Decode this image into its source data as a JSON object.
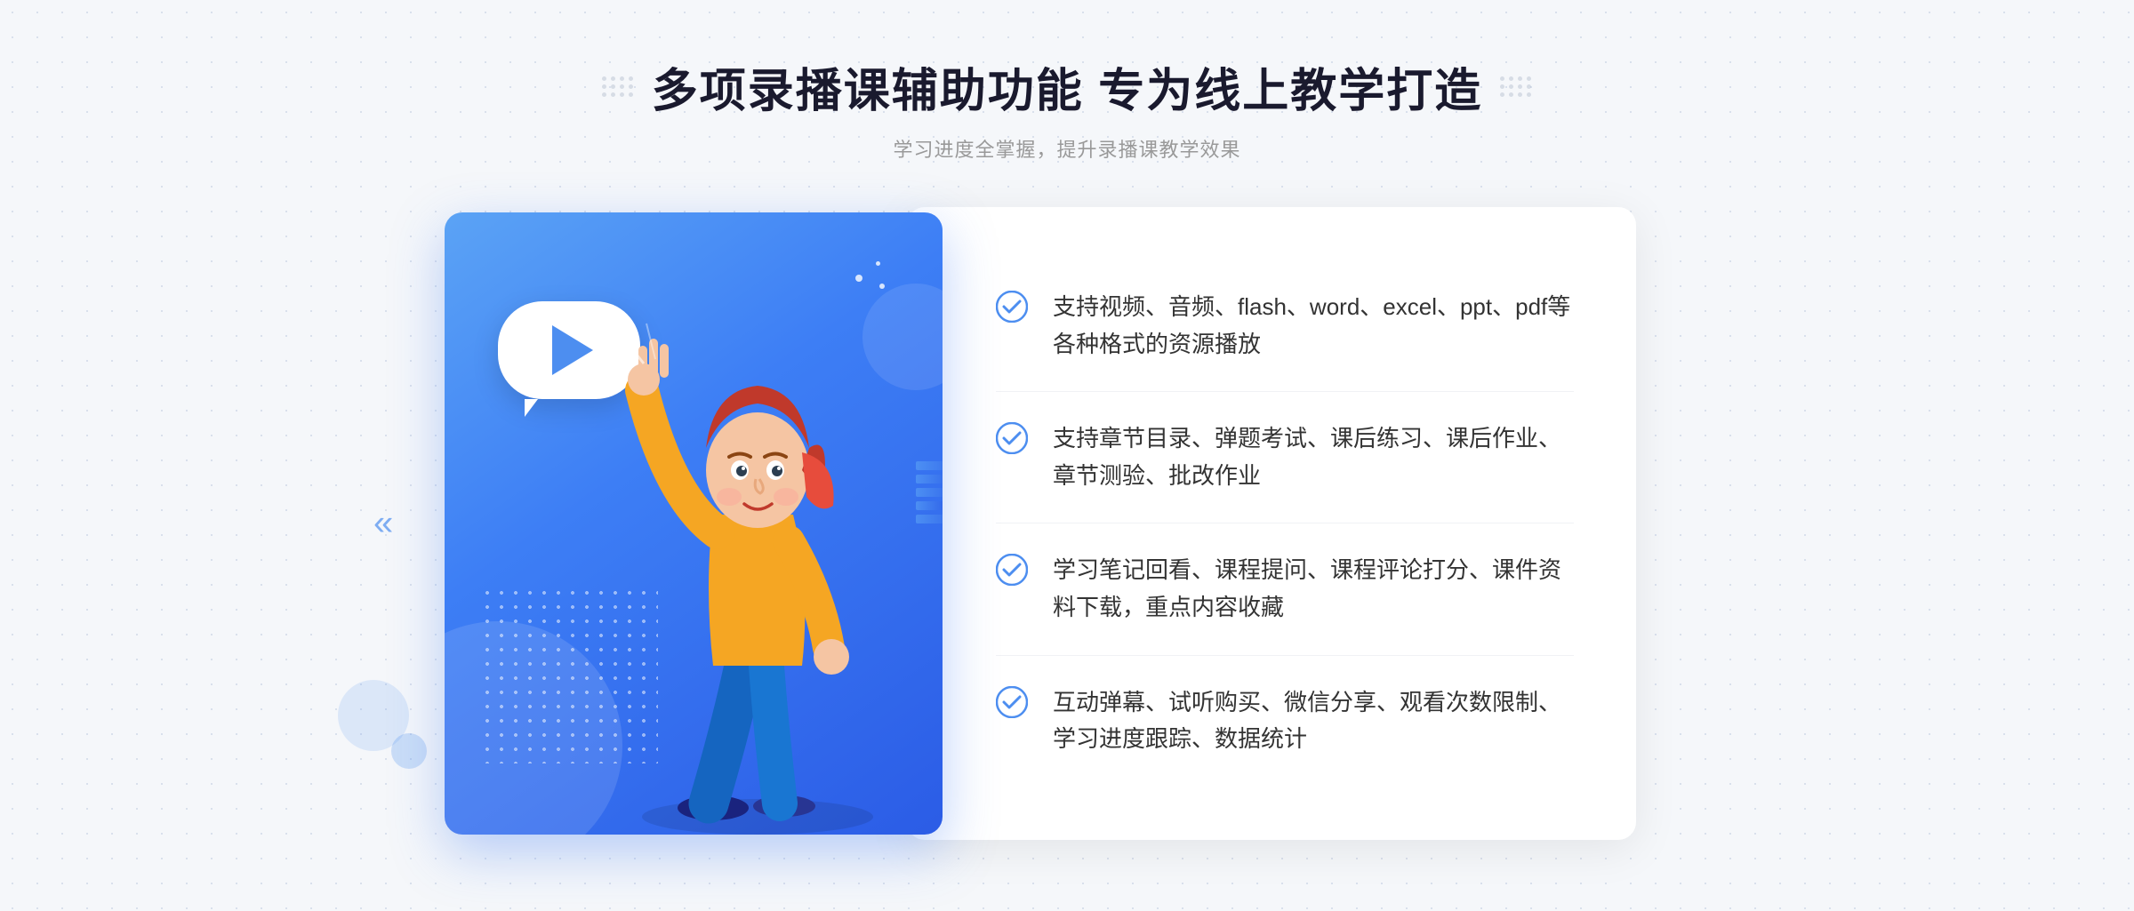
{
  "header": {
    "main_title": "多项录播课辅助功能 专为线上教学打造",
    "sub_title": "学习进度全掌握，提升录播课教学效果"
  },
  "features": [
    {
      "id": 1,
      "text": "支持视频、音频、flash、word、excel、ppt、pdf等各种格式的资源播放"
    },
    {
      "id": 2,
      "text": "支持章节目录、弹题考试、课后练习、课后作业、章节测验、批改作业"
    },
    {
      "id": 3,
      "text": "学习笔记回看、课程提问、课程评论打分、课件资料下载，重点内容收藏"
    },
    {
      "id": 4,
      "text": "互动弹幕、试听购买、微信分享、观看次数限制、学习进度跟踪、数据统计"
    }
  ],
  "decoration": {
    "left_arrow": "«",
    "play_button_label": "play"
  },
  "colors": {
    "primary_blue": "#4d8ef0",
    "gradient_start": "#5ba3f5",
    "gradient_end": "#2b5ce6",
    "text_dark": "#1a1a2e",
    "text_light": "#999999",
    "check_color": "#4d8ef0"
  }
}
